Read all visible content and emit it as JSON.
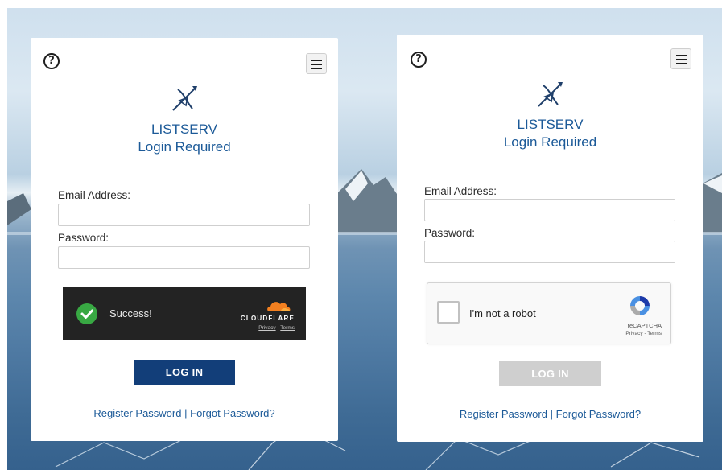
{
  "left_card": {
    "help_icon": "?",
    "menu_icon": "hamburger-menu",
    "logo_icon": "listserv-logo",
    "title_line1": "LISTSERV",
    "title_line2": "Login Required",
    "email_label": "Email Address:",
    "email_value": "",
    "password_label": "Password:",
    "password_value": "",
    "captcha": {
      "status_text": "Success!",
      "brand": "CLOUDFLARE",
      "privacy": "Privacy",
      "separator": "·",
      "terms": "Terms"
    },
    "login_button": "LOG IN",
    "register_link": "Register Password",
    "separator": "|",
    "forgot_link": "Forgot Password?"
  },
  "right_card": {
    "help_icon": "?",
    "menu_icon": "hamburger-menu",
    "logo_icon": "listserv-logo",
    "title_line1": "LISTSERV",
    "title_line2": "Login Required",
    "email_label": "Email Address:",
    "email_value": "",
    "password_label": "Password:",
    "password_value": "",
    "captcha": {
      "checkbox_label": "I'm not a robot",
      "brand": "reCAPTCHA",
      "links": "Privacy - Terms"
    },
    "login_button": "LOG IN",
    "register_link": "Register Password",
    "separator": "|",
    "forgot_link": "Forgot Password?"
  },
  "colors": {
    "brand_blue": "#1c5a98",
    "button_blue": "#123e79",
    "disabled_gray": "#cfcfcf",
    "cloudflare_dark": "#232323",
    "success_green": "#38a843"
  }
}
